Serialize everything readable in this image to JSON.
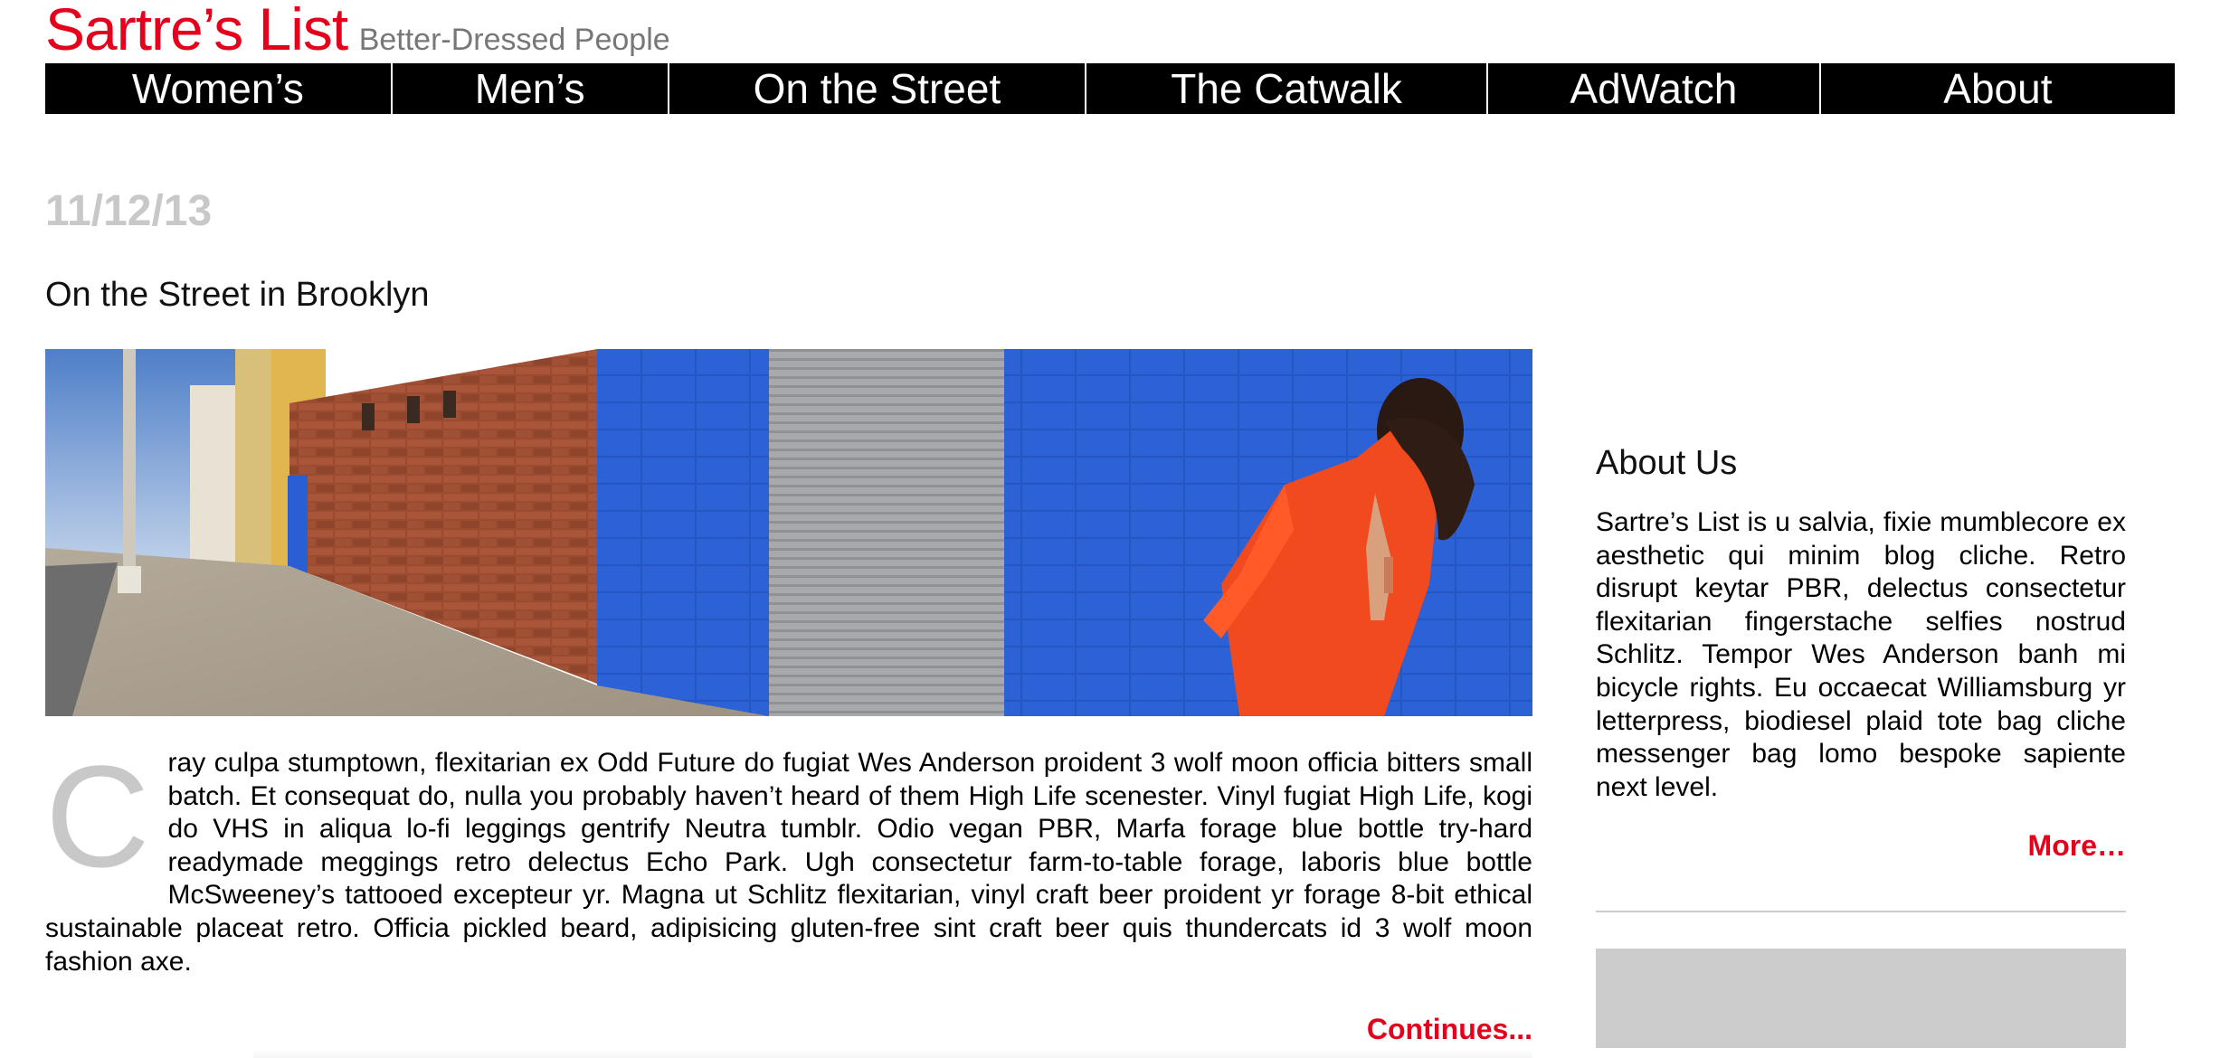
{
  "site": {
    "name": "Sartre’s List",
    "tagline": "Better-Dressed People"
  },
  "nav": {
    "items": [
      {
        "label": "Women’s"
      },
      {
        "label": "Men’s"
      },
      {
        "label": "On the Street"
      },
      {
        "label": "The Catwalk"
      },
      {
        "label": "AdWatch"
      },
      {
        "label": "About"
      }
    ]
  },
  "post": {
    "date": "11/12/13",
    "title": "On the Street in Brooklyn",
    "dropcap": "C",
    "body": "ray culpa stumptown, flexitarian ex Odd Future do fugiat Wes Anderson proident 3 wolf moon officia bitters small batch. Et consequat do, nulla you probably haven’t heard of them High Life scenester. Vinyl fugiat High Life, kogi do VHS in aliqua lo-fi leggings gentrify Neutra tumblr. Odio vegan PBR, Marfa forage blue bottle try-hard readymade meggings retro delectus Echo Park. Ugh consectetur farm-to-table forage, laboris blue bottle McSweeney’s tattooed excepteur yr. Magna ut Schlitz flexitarian, vinyl craft beer proident yr forage 8-bit ethical sustainable placeat retro. Officia pickled beard, adipisicing gluten-free sint craft beer quis thundercats id 3 wolf moon fashion axe.",
    "continue_label": "Continues..."
  },
  "sidebar": {
    "heading": "About Us",
    "text": "Sartre’s List is u salvia, fixie mumblecore ex aesthetic qui minim blog cliche. Retro disrupt keytar PBR, delectus consectetur flexitarian fingerstache selfies nostrud Schlitz. Tempor Wes Anderson banh mi bicycle rights. Eu occaecat Williamsburg yr letterpress, biodiesel plaid tote bag cliche messenger bag lomo bespoke sapiente next level.",
    "more_label": "More…"
  },
  "colors": {
    "brand_red": "#e5001b",
    "tagline_gray": "#777777",
    "date_gray": "#c8c8c8",
    "nav_bg": "#000000",
    "placeholder_gray": "#cccccc"
  }
}
